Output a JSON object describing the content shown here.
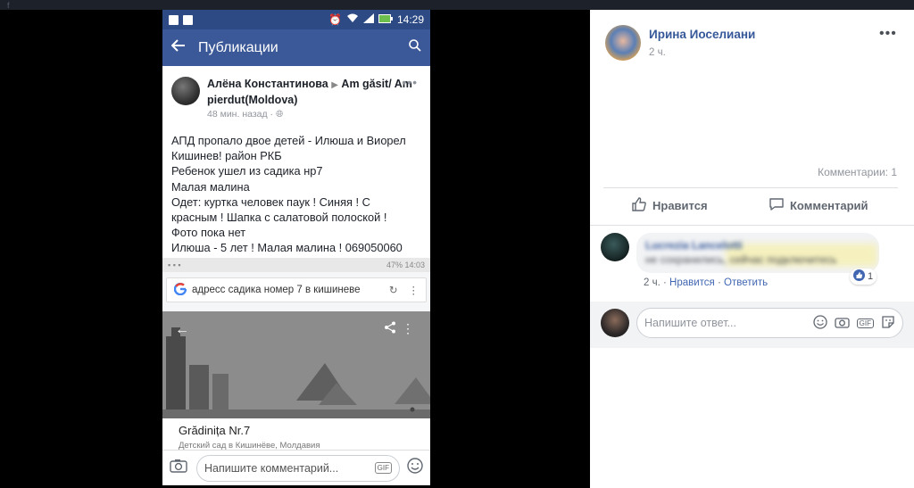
{
  "phone": {
    "status_time": "14:29",
    "appbar_title": "Публикации",
    "post": {
      "author": "Алёна Константинова",
      "arrow": "▶",
      "group": "Am găsit/ Am pierdut(Moldova)",
      "time": "48 мин. назад",
      "visibility_icon": "globe-icon",
      "body_lines": [
        "АПД пропало двое детей - Илюша и Виорел",
        "Кишинев! район РКБ",
        "Ребенок ушел из садика нр7",
        "Малая малина",
        "Одет: куртка человек паук ! Синяя ! С",
        "красным ! Шапка с салатовой полоской !",
        "Фото пока нет",
        "Илюша - 5 лет ! Малая малина ! 069050060"
      ]
    },
    "embed": {
      "status_right": "47% 14:03",
      "search_text": "адресс садика номер 7 в кишиневе",
      "place_name": "Grădinița Nr.7",
      "place_sub": "Детский сад в Кишинёве, Молдавия"
    },
    "comment_placeholder": "Напишите комментарий...",
    "gif_label": "GIF"
  },
  "fb": {
    "author": "Ирина Иоселиани",
    "time": "2 ч.",
    "comments_count": "Комментарии: 1",
    "like_label": "Нравится",
    "comment_label": "Комментарий",
    "comment": {
      "author_blurred": "Lucrezia Lancelotti",
      "text_blurred": "не сохранились, сейчас подключитесь",
      "time": "2 ч.",
      "like": "Нравится",
      "reply": "Ответить",
      "reaction_count": "1"
    },
    "reply_placeholder": "Напишите ответ...",
    "gif_label": "GIF"
  },
  "colors": {
    "fb_blue": "#3b5998",
    "status_blue": "#2d4a84",
    "link_blue": "#365899"
  }
}
